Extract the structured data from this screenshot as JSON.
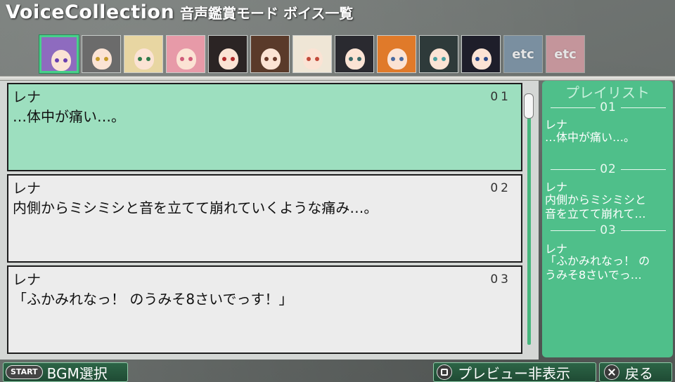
{
  "header": {
    "title": "VoiceCollection",
    "subtitle": "音声鑑賞モード ボイス一覧"
  },
  "characters": [
    {
      "name_icon": "character-portrait-1",
      "hair": "#8e6bbf",
      "eye": "#6a3fb0",
      "selected": true
    },
    {
      "name_icon": "character-portrait-2",
      "hair": "#6b6b6b",
      "eye": "#c79b2a",
      "selected": false
    },
    {
      "name_icon": "character-portrait-3",
      "hair": "#e8d6a2",
      "eye": "#2f7a4a",
      "selected": false
    },
    {
      "name_icon": "character-portrait-4",
      "hair": "#e79aa8",
      "eye": "#d05c7a",
      "selected": false
    },
    {
      "name_icon": "character-portrait-5",
      "hair": "#2b2424",
      "eye": "#b02a2a",
      "selected": false
    },
    {
      "name_icon": "character-portrait-6",
      "hair": "#5a3a2a",
      "eye": "#6a3a2a",
      "selected": false
    },
    {
      "name_icon": "character-portrait-7",
      "hair": "#efe6d6",
      "eye": "#c24a3a",
      "selected": false
    },
    {
      "name_icon": "character-portrait-8",
      "hair": "#2a2a30",
      "eye": "#3a6a6a",
      "selected": false
    },
    {
      "name_icon": "character-portrait-9",
      "hair": "#e07a2a",
      "eye": "#4a6aa0",
      "selected": false
    },
    {
      "name_icon": "character-portrait-10",
      "hair": "#2e3a3a",
      "eye": "#4aa0a0",
      "selected": false
    },
    {
      "name_icon": "character-portrait-11",
      "hair": "#1e1e2a",
      "eye": "#2a4a8a",
      "selected": false
    }
  ],
  "etc_tiles": [
    {
      "label": "etc",
      "color": "#7a8fa0"
    },
    {
      "label": "etc",
      "color": "#c4959b"
    }
  ],
  "voices": [
    {
      "speaker": "レナ",
      "number": "01",
      "line": "…体中が痛い…。",
      "highlighted": true
    },
    {
      "speaker": "レナ",
      "number": "02",
      "line": "内側からミシミシと音を立てて崩れていくような痛み…。",
      "highlighted": false
    },
    {
      "speaker": "レナ",
      "number": "03",
      "line": "「ふかみれなっ！ のうみそ8さいでっす！」",
      "highlighted": false
    }
  ],
  "playlist": {
    "title": "プレイリスト",
    "items": [
      {
        "number": "01",
        "speaker": "レナ",
        "text_lines": [
          "…体中が痛い…。"
        ]
      },
      {
        "number": "02",
        "speaker": "レナ",
        "text_lines": [
          "内側からミシミシと",
          "音を立てて崩れて…"
        ]
      },
      {
        "number": "03",
        "speaker": "レナ",
        "text_lines": [
          "「ふかみれなっ！ の",
          "うみそ8さいでっ…"
        ]
      }
    ]
  },
  "footer": {
    "start_label": "START",
    "bgm_label": "BGM選択",
    "preview_label": "プレビュー非表示",
    "back_label": "戻る"
  },
  "colors": {
    "accent_green": "#4fbf8a",
    "highlight_row": "#9ddfbf",
    "selected_border": "#48d08a"
  }
}
